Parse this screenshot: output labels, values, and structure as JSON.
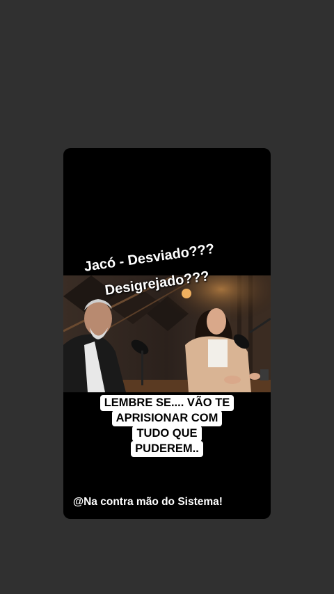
{
  "story": {
    "title_line_1": "Jacó - Desviado???",
    "title_line_2": "Desigrejado???",
    "caption_lines": [
      "LEMBRE SE.... VÃO TE",
      "APRISIONAR COM",
      "TUDO QUE",
      "PUDEREM.."
    ],
    "footer": "@Na contra mão do Sistema!"
  },
  "video": {
    "description_icon": "podcast-video-frame"
  },
  "colors": {
    "page_background": "#303030",
    "card_background": "#000000",
    "caption_background": "#ffffff",
    "text_light": "#ffffff"
  }
}
